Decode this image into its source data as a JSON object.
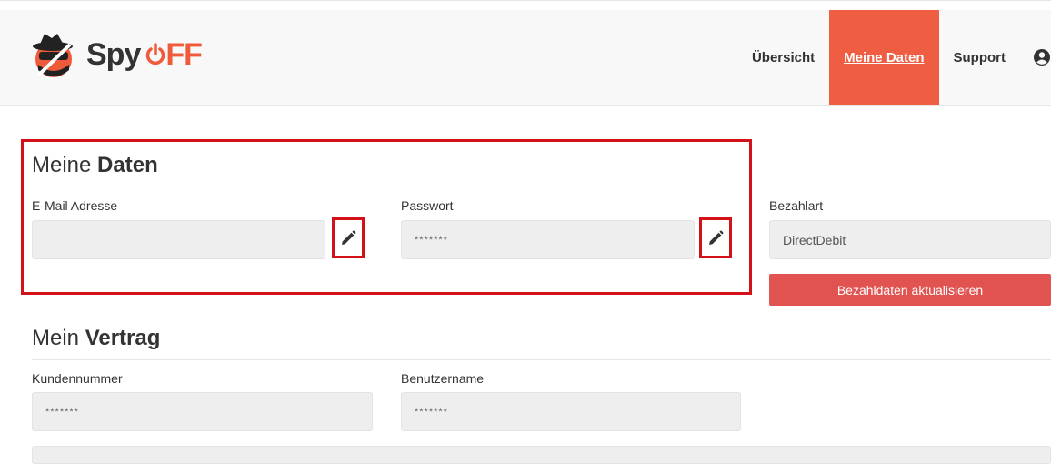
{
  "brand": {
    "name_part1": "Spy",
    "name_part2": "FF",
    "accent": "#ef5a3a"
  },
  "nav": {
    "items": [
      {
        "label": "Übersicht",
        "active": false
      },
      {
        "label": "Meine Daten",
        "active": true
      },
      {
        "label": "Support",
        "active": false
      }
    ],
    "user_icon": "user-circle-icon"
  },
  "meine_daten": {
    "title_light": "Meine ",
    "title_bold": "Daten",
    "email": {
      "label": "E-Mail Adresse",
      "value": ""
    },
    "password": {
      "label": "Passwort",
      "value": "*******"
    },
    "payment": {
      "label": "Bezahlart",
      "value": "DirectDebit",
      "button_label": "Bezahldaten aktualisieren"
    },
    "edit_icon": "pencil-icon"
  },
  "mein_vertrag": {
    "title_light": "Mein ",
    "title_bold": "Vertrag",
    "customer_number": {
      "label": "Kundennummer",
      "value": "*******"
    },
    "username": {
      "label": "Benutzername",
      "value": "*******"
    }
  },
  "colors": {
    "highlight": "#d21118",
    "button": "#e05350",
    "nav_active": "#ef5d42"
  }
}
